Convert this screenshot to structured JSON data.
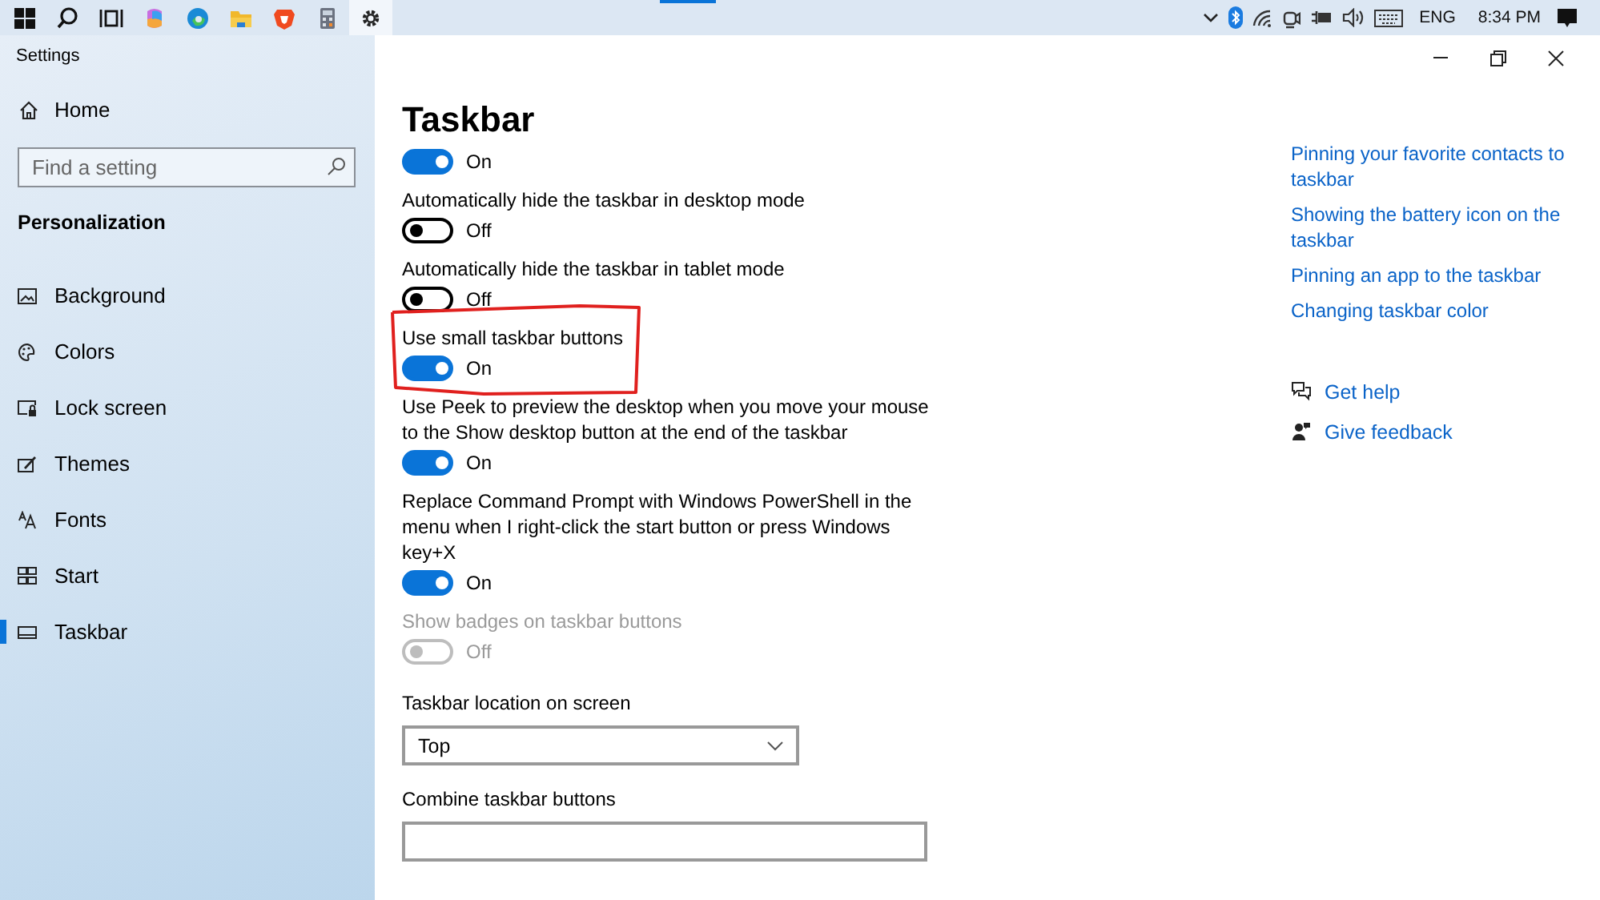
{
  "taskbar": {
    "apps": [
      {
        "kind": "start",
        "selected": false
      },
      {
        "kind": "search",
        "selected": false
      },
      {
        "kind": "taskview",
        "selected": false
      },
      {
        "kind": "copilot",
        "selected": false
      },
      {
        "kind": "edge",
        "selected": false
      },
      {
        "kind": "folder",
        "selected": false
      },
      {
        "kind": "brave",
        "selected": false
      },
      {
        "kind": "calculator",
        "selected": false
      },
      {
        "kind": "settings",
        "selected": true
      }
    ],
    "tray": {
      "language": "ENG",
      "time": "8:34 PM"
    }
  },
  "window": {
    "title": "Settings"
  },
  "sidebar": {
    "home": "Home",
    "search": {
      "placeholder": "Find a setting"
    },
    "section": "Personalization",
    "items": [
      {
        "kind": "background",
        "label": "Background",
        "selected": false
      },
      {
        "kind": "colors",
        "label": "Colors",
        "selected": false
      },
      {
        "kind": "lock",
        "label": "Lock screen",
        "selected": false
      },
      {
        "kind": "themes",
        "label": "Themes",
        "selected": false
      },
      {
        "kind": "fonts",
        "label": "Fonts",
        "selected": false
      },
      {
        "kind": "start",
        "label": "Start",
        "selected": false
      },
      {
        "kind": "taskbar",
        "label": "Taskbar",
        "selected": true
      }
    ]
  },
  "page": {
    "title": "Taskbar",
    "settings": [
      {
        "kind": "toggle",
        "on": true,
        "state": "On",
        "disabled": false,
        "annotated": false
      },
      {
        "kind": "toggle",
        "label": "Automatically hide the taskbar in desktop mode",
        "on": false,
        "state": "Off",
        "disabled": false,
        "annotated": false
      },
      {
        "kind": "toggle",
        "label": "Automatically hide the taskbar in tablet mode",
        "on": false,
        "state": "Off",
        "disabled": false,
        "annotated": false
      },
      {
        "kind": "toggle",
        "label": "Use small taskbar buttons",
        "on": true,
        "state": "On",
        "disabled": false,
        "annotated": true
      },
      {
        "kind": "toggle",
        "label": "Use Peek to preview the desktop when you move your mouse to the Show desktop button at the end of the taskbar",
        "on": true,
        "state": "On",
        "disabled": false,
        "annotated": false
      },
      {
        "kind": "toggle",
        "label": "Replace Command Prompt with Windows PowerShell in the menu when I right-click the start button or press Windows key+X",
        "on": true,
        "state": "On",
        "disabled": false,
        "annotated": false
      },
      {
        "kind": "toggle",
        "label": "Show badges on taskbar buttons",
        "on": false,
        "state": "Off",
        "disabled": true,
        "annotated": false
      },
      {
        "kind": "dropdown",
        "label": "Taskbar location on screen",
        "value": "Top",
        "wide": false
      },
      {
        "kind": "dropdown",
        "label": "Combine taskbar buttons",
        "wide": true
      }
    ]
  },
  "related": {
    "links": [
      "Pinning your favorite contacts to taskbar",
      "Showing the battery icon on the taskbar",
      "Pinning an app to the taskbar",
      "Changing taskbar color"
    ],
    "help": [
      {
        "kind": "help",
        "label": "Get help"
      },
      {
        "kind": "feedback",
        "label": "Give feedback"
      }
    ]
  }
}
